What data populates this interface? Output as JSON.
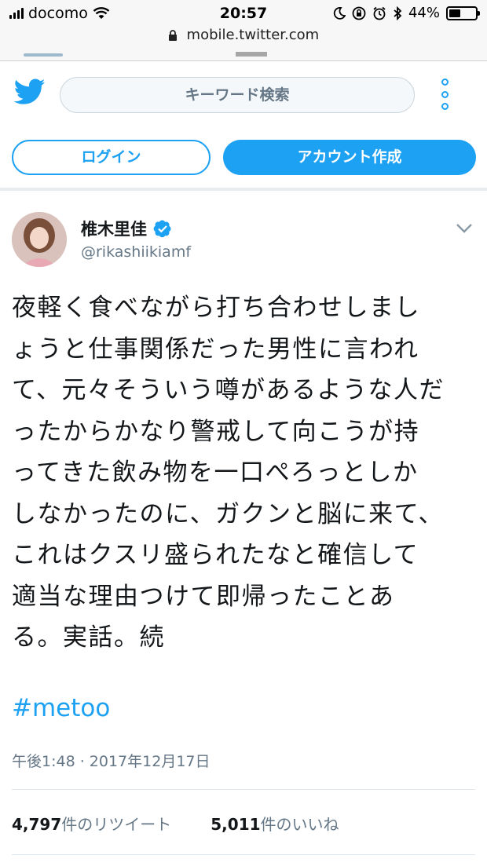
{
  "status_bar": {
    "carrier": "docomo",
    "time": "20:57",
    "battery_percent": "44%",
    "battery_level": 0.44,
    "icons": [
      "signal-icon",
      "wifi-icon",
      "moon-icon",
      "rotation-lock-icon",
      "alarm-icon",
      "bluetooth-icon",
      "battery-icon"
    ]
  },
  "browser": {
    "url": "mobile.twitter.com"
  },
  "header": {
    "search_placeholder": "キーワード検索",
    "login_label": "ログイン",
    "signup_label": "アカウント作成"
  },
  "tweet": {
    "author_name": "椎木里佳",
    "author_handle": "@rikashiikiamf",
    "text_lines": [
      "夜軽く食べながら打ち合わせしまし",
      "ょうと仕事関係だった男性に言われ",
      "て、元々そういう噂があるような人だ",
      "ったからかなり警戒して向こうが持",
      "ってきた飲み物を一口ぺろっとしか",
      "しなかったのに、ガクンと脳に来て、",
      "これはクスリ盛られたなと確信して",
      "適当な理由つけて即帰ったことあ",
      "る。実話。続"
    ],
    "hashtag": "#metoo",
    "timestamp": "午後1:48 · 2017年12月17日",
    "retweet_count": "4,797",
    "retweet_label": "件のリツイート",
    "like_count": "5,011",
    "like_label": "件のいいね"
  },
  "colors": {
    "twitter_blue": "#1da1f2",
    "secondary_text": "#657786",
    "primary_text": "#14171a"
  }
}
